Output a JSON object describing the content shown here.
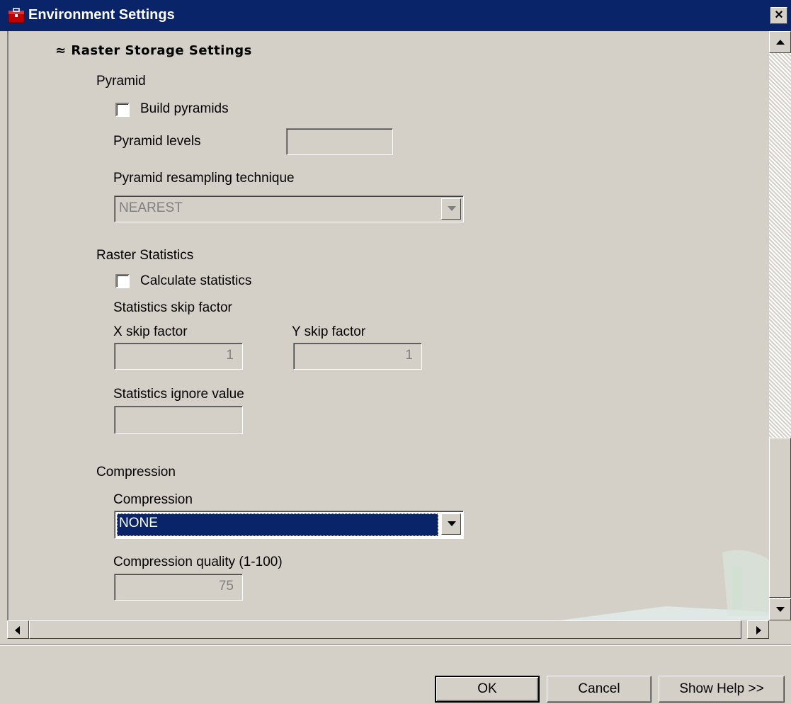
{
  "window": {
    "title": "Environment Settings",
    "close_label": "×"
  },
  "section": {
    "collapse_glyph": "≈",
    "title": "Raster Storage Settings"
  },
  "pyramid": {
    "group_label": "Pyramid",
    "build_label": "Build pyramids",
    "build_checked": false,
    "levels_label": "Pyramid levels",
    "levels_value": "",
    "resampling_label": "Pyramid resampling technique",
    "resampling_value": "NEAREST"
  },
  "stats": {
    "group_label": "Raster Statistics",
    "calc_label": "Calculate statistics",
    "calc_checked": false,
    "skip_label": "Statistics skip factor",
    "x_label": "X skip factor",
    "x_value": "1",
    "y_label": "Y skip factor",
    "y_value": "1",
    "ignore_label": "Statistics ignore value",
    "ignore_value": ""
  },
  "compression": {
    "group_label": "Compression",
    "type_label": "Compression",
    "type_value": "NONE",
    "quality_label": "Compression quality (1-100)",
    "quality_value": "75"
  },
  "buttons": {
    "ok": "OK",
    "cancel": "Cancel",
    "help": "Show Help >>"
  },
  "colors": {
    "titlebar": "#0a246a",
    "selection": "#0a246a",
    "face": "#d4d0c8",
    "disabled_text": "#808080"
  },
  "icons": {
    "title": "toolbox-icon"
  }
}
